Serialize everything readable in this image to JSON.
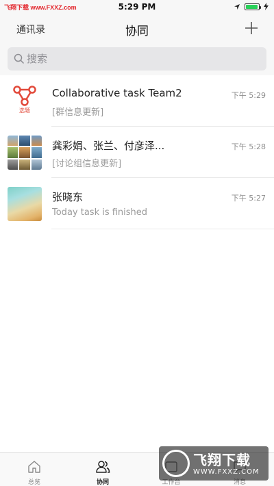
{
  "status_bar": {
    "watermark": "飞翔下载 www.FXXZ.com",
    "time": "5:29 PM",
    "battery_level": 0.95,
    "battery_color": "#2bd15a"
  },
  "nav": {
    "left_label": "通讯录",
    "title": "协同",
    "right_icon": "plus-icon"
  },
  "search": {
    "placeholder": "搜索"
  },
  "chats": [
    {
      "name": "Collaborative task Team2",
      "preview": "[群信息更新]",
      "time": "下午 5:29",
      "avatar_label": "选题",
      "avatar_type": "team-icon"
    },
    {
      "name": "龚彩娟、张兰、付彦泽...",
      "preview": "[讨论组信息更新]",
      "time": "下午 5:28",
      "avatar_type": "group-mosaic"
    },
    {
      "name": "张晓东",
      "preview": "Today task is finished",
      "time": "下午 5:27",
      "avatar_type": "photo"
    }
  ],
  "tabs": [
    {
      "label": "总览",
      "icon": "home-icon",
      "active": false
    },
    {
      "label": "协同",
      "icon": "people-icon",
      "active": true
    },
    {
      "label": "工作台",
      "icon": "workbench-icon",
      "active": false
    },
    {
      "label": "消息",
      "icon": "message-icon",
      "active": false
    }
  ],
  "watermark_bottom": {
    "title": "飞翔下载",
    "url": "WWW.FXXZ.COM"
  },
  "colors": {
    "accent_red": "#e24a3b",
    "bar_background": "#f7f7f7",
    "search_background": "#e6e6e8"
  }
}
